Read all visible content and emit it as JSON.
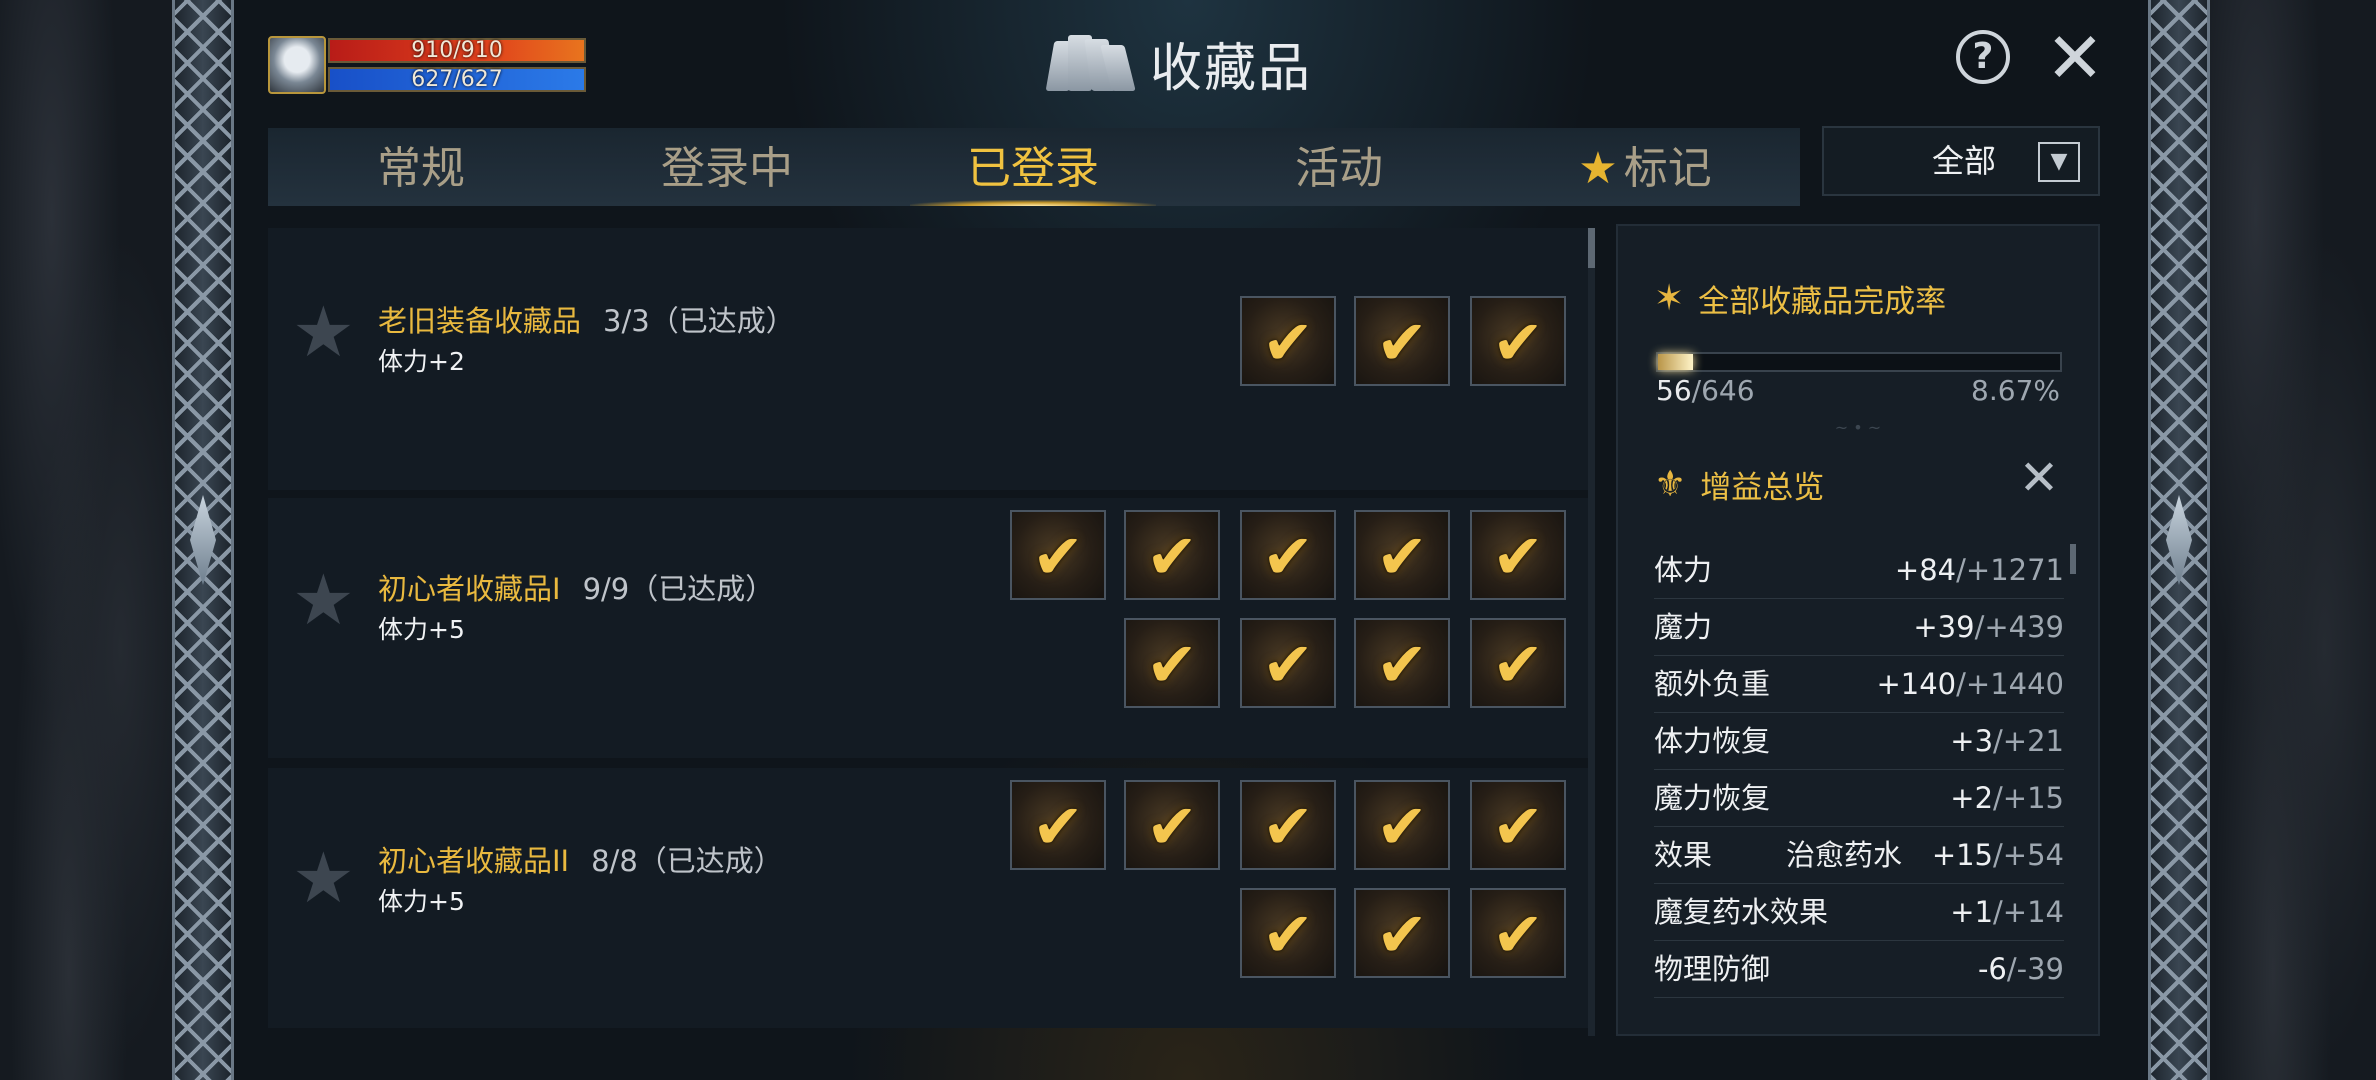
{
  "player": {
    "hp_text": "910/910",
    "mp_text": "627/627",
    "hp_fraction": 1.0,
    "mp_fraction": 1.0
  },
  "window": {
    "title": "收藏品",
    "title_icon": "books-icon",
    "help_icon": "question-circle-icon",
    "close_icon": "close-icon"
  },
  "tabs": [
    {
      "label": "常规",
      "active": false
    },
    {
      "label": "登录中",
      "active": false
    },
    {
      "label": "已登录",
      "active": true
    },
    {
      "label": "活动",
      "active": false
    },
    {
      "label": "标记",
      "active": false,
      "icon": "star-icon"
    }
  ],
  "filter": {
    "selected": "全部",
    "icon": "dropdown-arrow-icon"
  },
  "collections": [
    {
      "name": "老旧装备收藏品",
      "count": "3/3（已达成）",
      "effect": "体力+2",
      "items_completed": 3,
      "items_total": 3
    },
    {
      "name": "初心者收藏品I",
      "count": "9/9（已达成）",
      "effect": "体力+5",
      "items_completed": 9,
      "items_total": 9
    },
    {
      "name": "初心者收藏品II",
      "count": "8/8（已达成）",
      "effect": "体力+5",
      "items_completed": 8,
      "items_total": 8
    }
  ],
  "summary": {
    "completion_title": "全部收藏品完成率",
    "completed": "56",
    "total": "/646",
    "percent": "8.67%",
    "completion_fraction": 0.0867,
    "bonus_title": "增益总览"
  },
  "stats": [
    {
      "name": "体力",
      "sub": "",
      "cur": "+84",
      "max": "/+1271"
    },
    {
      "name": "魔力",
      "sub": "",
      "cur": "+39",
      "max": "/+439"
    },
    {
      "name": "额外负重",
      "sub": "",
      "cur": "+140",
      "max": "/+1440"
    },
    {
      "name": "体力恢复",
      "sub": "",
      "cur": "+3",
      "max": "/+21"
    },
    {
      "name": "魔力恢复",
      "sub": "",
      "cur": "+2",
      "max": "/+15"
    },
    {
      "name": "效果",
      "sub": "治愈药水",
      "cur": "+15",
      "max": "/+54"
    },
    {
      "name": "魔复药水效果",
      "sub": "",
      "cur": "+1",
      "max": "/+14"
    },
    {
      "name": "物理防御",
      "sub": "",
      "cur": "-6",
      "max": "/-39"
    }
  ],
  "colors": {
    "accent_gold": "#e9b93f",
    "hp_red": "#c8261a",
    "mp_blue": "#2266d8",
    "panel_bg": "#131b23"
  }
}
